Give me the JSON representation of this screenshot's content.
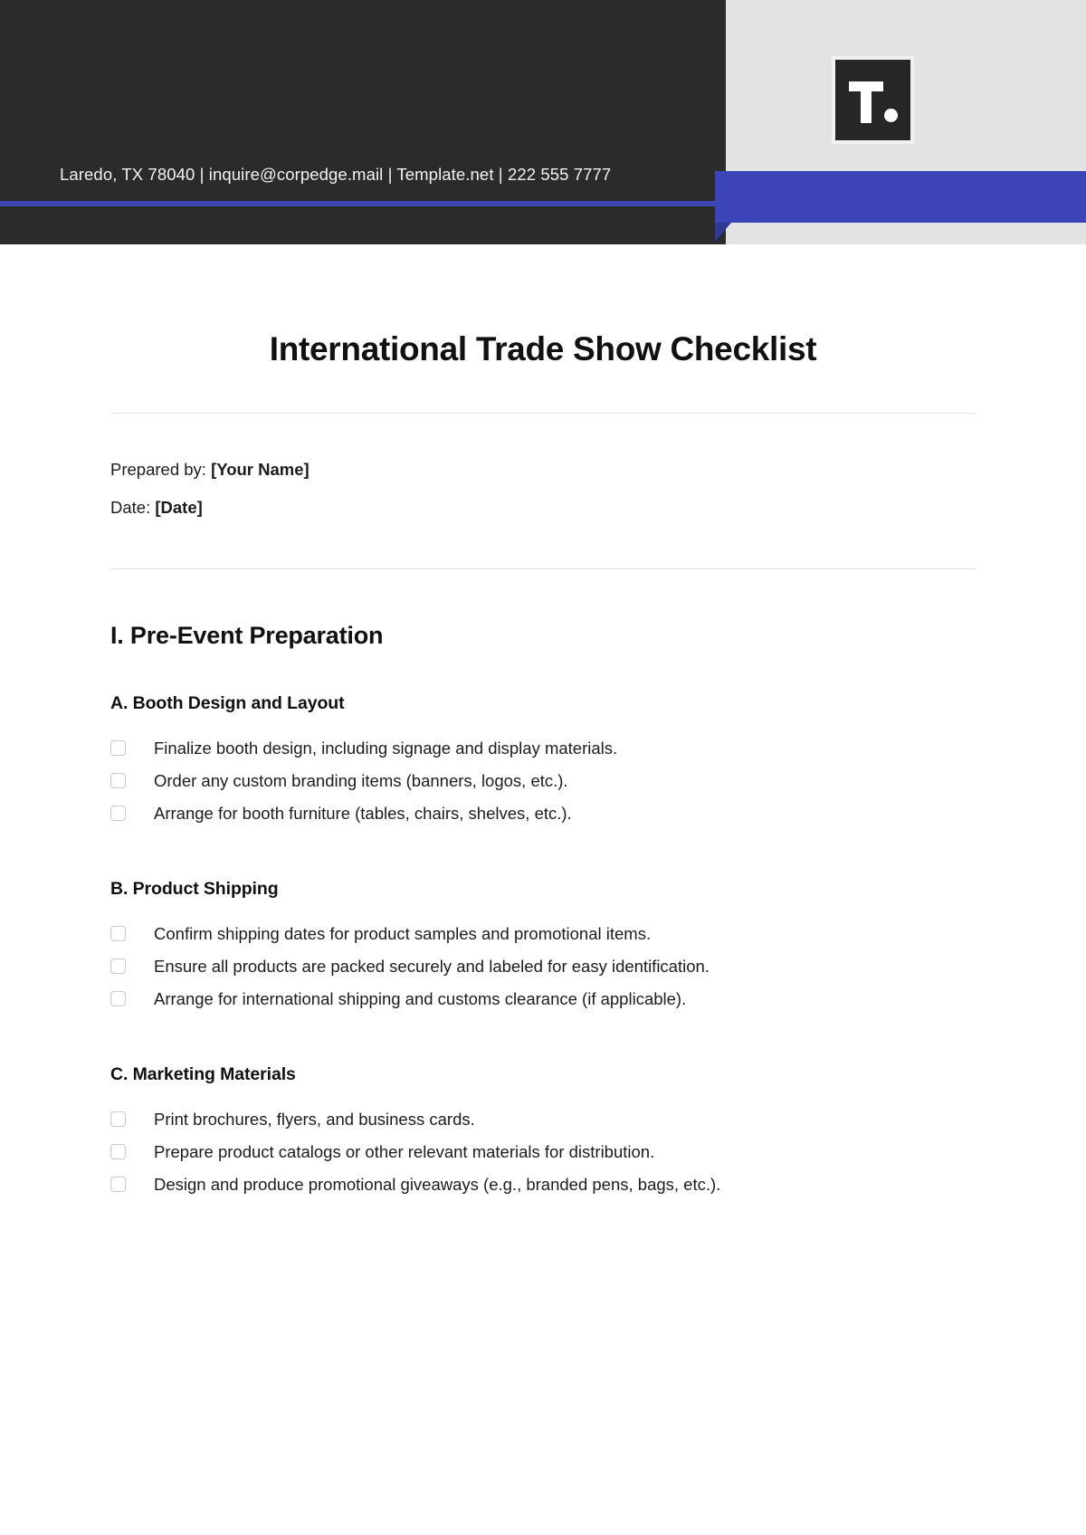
{
  "header": {
    "contact_line": "Laredo, TX 78040 | inquire@corpedge.mail | Template.net | 222 555 7777",
    "logo_text": "T.",
    "colors": {
      "dark": "#2b2b2b",
      "light": "#e3e3e3",
      "accent_blue": "#3b45b8"
    }
  },
  "document": {
    "title": "International Trade Show Checklist",
    "meta": [
      {
        "label": "Prepared by:",
        "value": "[Your Name]"
      },
      {
        "label": "Date:",
        "value": "[Date]"
      }
    ],
    "sections": [
      {
        "heading": "I. Pre-Event Preparation",
        "subsections": [
          {
            "heading": "A. Booth Design and Layout",
            "items": [
              "Finalize booth design, including signage and display materials.",
              "Order any custom branding items (banners, logos, etc.).",
              "Arrange for booth furniture (tables, chairs, shelves, etc.)."
            ]
          },
          {
            "heading": "B. Product Shipping",
            "items": [
              "Confirm shipping dates for product samples and promotional items.",
              "Ensure all products are packed securely and labeled for easy identification.",
              "Arrange for international shipping and customs clearance (if applicable)."
            ]
          },
          {
            "heading": "C. Marketing Materials",
            "items": [
              "Print brochures, flyers, and business cards.",
              "Prepare product catalogs or other relevant materials for distribution.",
              "Design and produce promotional giveaways (e.g., branded pens, bags, etc.)."
            ]
          }
        ]
      }
    ]
  }
}
